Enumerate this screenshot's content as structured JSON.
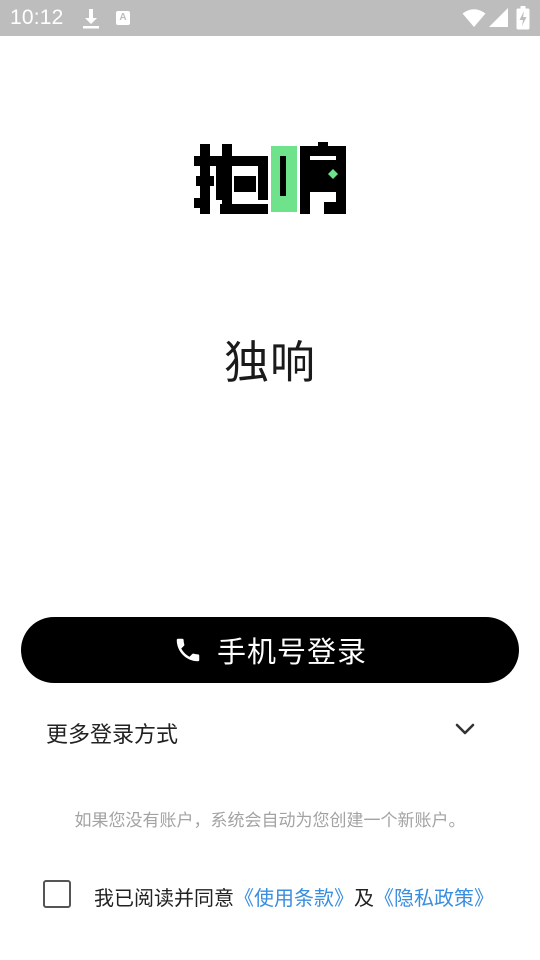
{
  "status_bar": {
    "time": "10:12",
    "icons": [
      "download-icon",
      "a-notification-icon",
      "wifi-icon",
      "cellular-signal-icon",
      "battery-charging-icon"
    ]
  },
  "app": {
    "name": "独响",
    "logo_accent_color": "#6fe38c"
  },
  "login": {
    "phone_button_label": "手机号登录",
    "more_options_label": "更多登录方式",
    "hint": "如果您没有账户，系统会自动为您创建一个新账户。"
  },
  "agreement": {
    "prefix": "我已阅读并同意",
    "terms_link": "《使用条款》",
    "conjunction": "及",
    "privacy_link": "《隐私政策》",
    "checked": false
  },
  "colors": {
    "status_bar": "#bdbdbd",
    "primary_button": "#000000",
    "link": "#3a8ee0",
    "hint_text": "#a3a3a3"
  }
}
